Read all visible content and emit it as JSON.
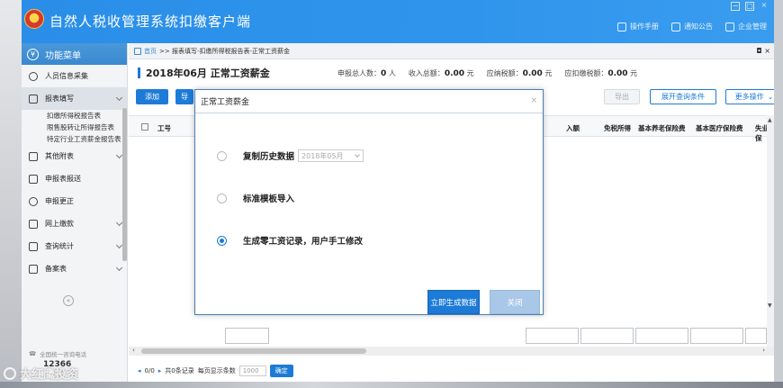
{
  "app": {
    "title": "自然人税收管理系统扣缴客户端",
    "window_controls": [
      "−",
      "▢",
      "×"
    ]
  },
  "top_links": [
    {
      "icon": "manual-icon",
      "label": "操作手册"
    },
    {
      "icon": "mail-icon",
      "label": "通知公告"
    },
    {
      "icon": "building-icon",
      "label": "企业管理"
    }
  ],
  "sidebar": {
    "header": "功能菜单",
    "items": [
      {
        "icon": "person-icon",
        "label": "人员信息采集"
      },
      {
        "icon": "edit-icon",
        "label": "报表填写"
      },
      {
        "icon": "grid-icon",
        "label": "其他附表"
      },
      {
        "icon": "send-icon",
        "label": "申报表报送"
      },
      {
        "icon": "search-icon",
        "label": "申报更正"
      },
      {
        "icon": "folder-icon",
        "label": "网上缴款"
      },
      {
        "icon": "query-icon",
        "label": "查询统计"
      },
      {
        "icon": "doc-icon",
        "label": "备案表"
      }
    ],
    "sub_items": [
      "扣缴所得税报告表",
      "限售股转让所得报告表",
      "特定行业工资薪金报告表"
    ],
    "hotline_label": "全国统一咨询电话",
    "hotline_number": "12366"
  },
  "breadcrumb": {
    "home": "首页",
    "path": ">> 报表填写-扣缴所得税报告表-正常工资薪金",
    "tab_controls": "◘ ×"
  },
  "report": {
    "period_title": "2018年06月  正常工资薪金",
    "stats": [
      {
        "label": "申报总人数：",
        "value": "0",
        "unit": "人"
      },
      {
        "label": "收入总额：",
        "value": "0.00",
        "unit": "元"
      },
      {
        "label": "应纳税额：",
        "value": "0.00",
        "unit": "元"
      },
      {
        "label": "应扣缴税额：",
        "value": "0.00",
        "unit": "元"
      }
    ]
  },
  "toolbar": {
    "add": "添加",
    "import": "导",
    "export": "导出",
    "expand_query": "展开查询条件",
    "more_ops": "更多操作"
  },
  "table": {
    "columns": [
      "工号",
      "入额",
      "免税所得",
      "基本养老保险费",
      "基本医疗保险费",
      "失业保"
    ]
  },
  "pager": {
    "nav": "0/0",
    "total": "共0条记录",
    "per_page_label": "每页显示条数",
    "per_page_value": "1000",
    "confirm": "确定"
  },
  "modal": {
    "title": "正常工资薪金",
    "close": "×",
    "options": [
      {
        "label": "复制历史数据",
        "selected": false,
        "month": "2018年05月"
      },
      {
        "label": "标准模板导入",
        "selected": false
      },
      {
        "label": "生成零工资记录，用户手工修改",
        "selected": true
      }
    ],
    "generate_button": "立即生成数据",
    "close_button": "关闭"
  },
  "watermark": "大红鹰投资"
}
